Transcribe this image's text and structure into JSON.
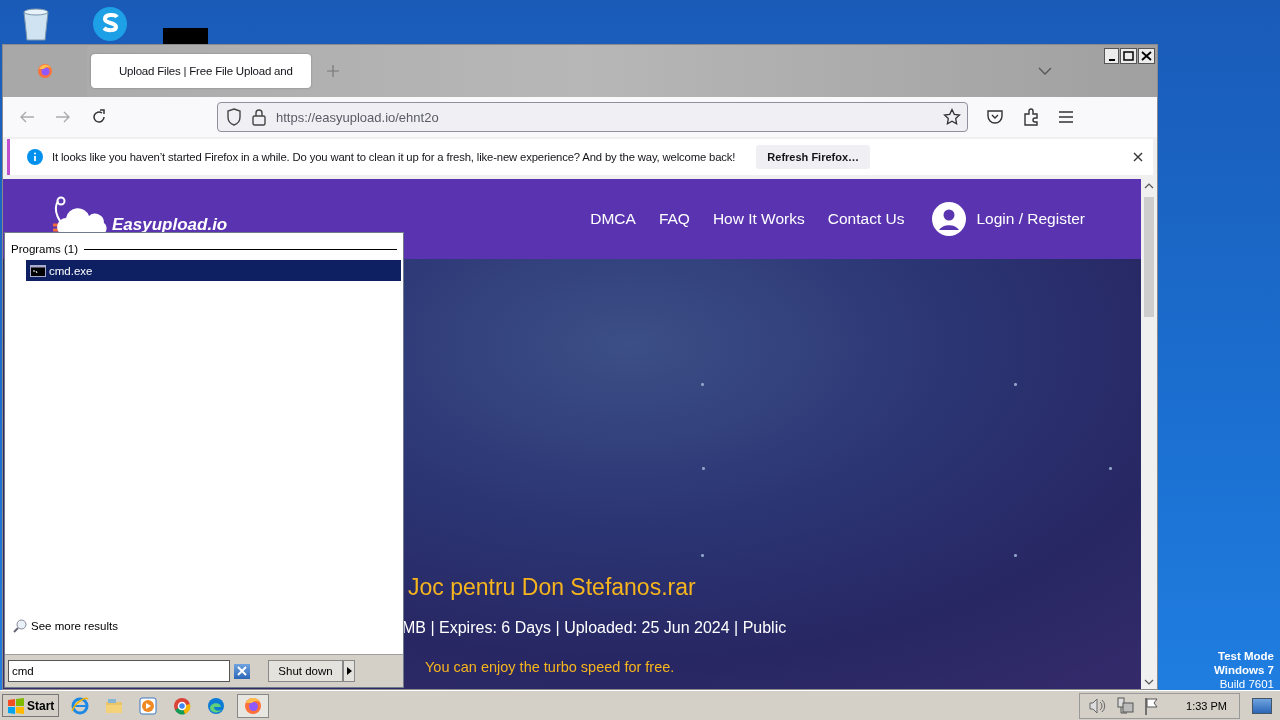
{
  "browser": {
    "tabs": [
      {
        "title": "Upload Files | Free File Upload and",
        "selected": true
      }
    ],
    "url": "https://easyupload.io/ehnt2o",
    "notification": {
      "message": "It looks like you haven’t started Firefox in a while. Do you want to clean it up for a fresh, like-new experience? And by the way, welcome back!",
      "button": "Refresh Firefox…"
    }
  },
  "site": {
    "logo": "Easyupload.io",
    "nav": [
      "DMCA",
      "FAQ",
      "How It Works",
      "Contact Us"
    ],
    "login": "Login / Register",
    "file_title": "Joc pentru Don Stefanos.rar",
    "meta": "MB | Expires: 6 Days | Uploaded: 25 Jun 2024 | Public",
    "promo": "You can enjoy the turbo speed for free."
  },
  "start_menu": {
    "section": "Programs (1)",
    "results": [
      {
        "label": "cmd.exe",
        "selected": true
      }
    ],
    "see_more": "See more results",
    "search_value": "cmd",
    "shutdown": "Shut down"
  },
  "taskbar": {
    "start": "Start",
    "apps": [
      {
        "kind": "ie",
        "selected": false
      },
      {
        "kind": "explorer",
        "selected": false
      },
      {
        "kind": "media",
        "selected": false
      },
      {
        "kind": "chrome",
        "selected": false
      },
      {
        "kind": "edge",
        "selected": false
      },
      {
        "kind": "firefox",
        "selected": true
      }
    ],
    "clock": "1:33 PM"
  },
  "desktop_note": [
    "Test Mode",
    "Windows 7",
    "Build 7601"
  ]
}
